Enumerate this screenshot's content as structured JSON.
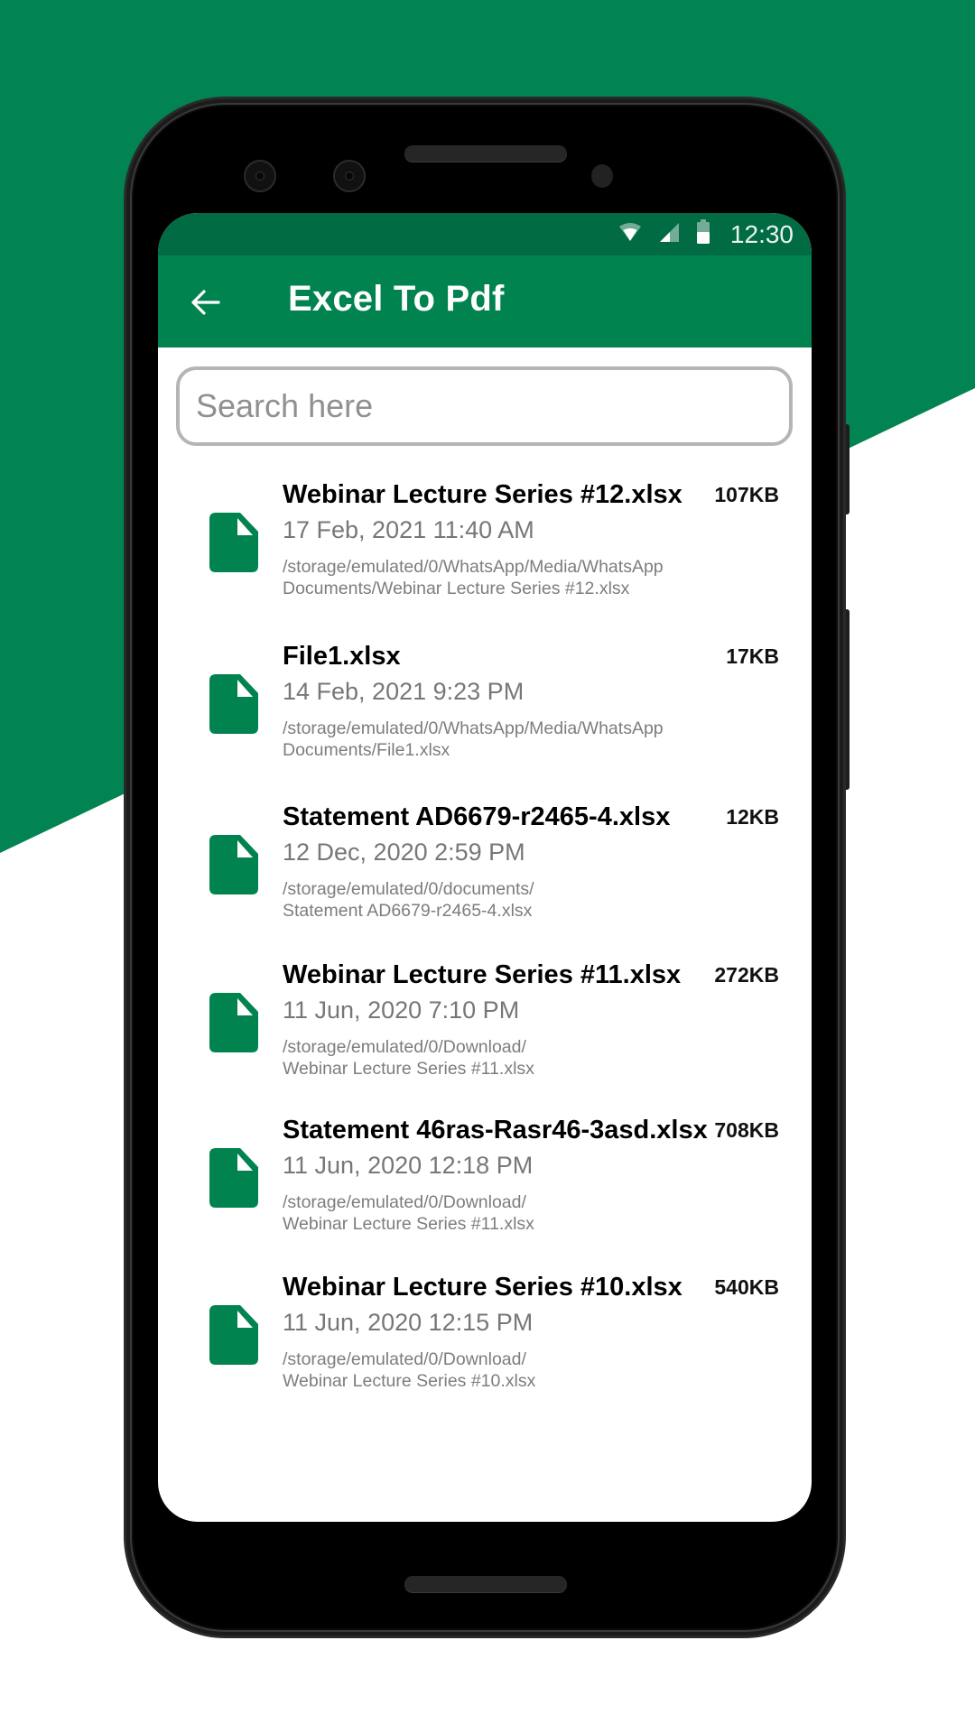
{
  "theme": {
    "brand": "#018350",
    "status_bar": "#016b43",
    "background_accent": "#028452"
  },
  "status_bar": {
    "time": "12:30",
    "icons": [
      "wifi-icon",
      "cellular-signal-icon",
      "battery-icon"
    ]
  },
  "app_bar": {
    "back_icon": "arrow-back-icon",
    "title": "Excel To Pdf"
  },
  "search": {
    "placeholder": "Search here",
    "value": ""
  },
  "files": [
    {
      "name": "Webinar Lecture Series #12.xlsx",
      "size": "107KB",
      "date": "17 Feb, 2021 11:40 AM",
      "path_line1": "/storage/emulated/0/WhatsApp/Media/WhatsApp",
      "path_line2": "Documents/Webinar Lecture Series #12.xlsx",
      "icon": "file-icon"
    },
    {
      "name": "File1.xlsx",
      "size": "17KB",
      "date": "14 Feb, 2021 9:23 PM",
      "path_line1": "/storage/emulated/0/WhatsApp/Media/WhatsApp",
      "path_line2": "Documents/File1.xlsx",
      "icon": "file-icon"
    },
    {
      "name": "Statement AD6679-r2465-4.xlsx",
      "size": "12KB",
      "date": "12 Dec, 2020 2:59 PM",
      "path_line1": "/storage/emulated/0/documents/",
      "path_line2": "Statement AD6679-r2465-4.xlsx",
      "icon": "file-icon"
    },
    {
      "name": "Webinar Lecture Series #11.xlsx",
      "size": "272KB",
      "date": "11 Jun, 2020 7:10 PM",
      "path_line1": "/storage/emulated/0/Download/",
      "path_line2": "Webinar Lecture Series #11.xlsx",
      "icon": "file-icon"
    },
    {
      "name": "Statement 46ras-Rasr46-3asd.xlsx",
      "size": "708KB",
      "date": "11 Jun, 2020 12:18 PM",
      "path_line1": "/storage/emulated/0/Download/",
      "path_line2": "Webinar Lecture Series #11.xlsx",
      "icon": "file-icon"
    },
    {
      "name": "Webinar Lecture Series #10.xlsx",
      "size": "540KB",
      "date": "11 Jun, 2020 12:15 PM",
      "path_line1": "/storage/emulated/0/Download/",
      "path_line2": "Webinar Lecture Series #10.xlsx",
      "icon": "file-icon"
    }
  ]
}
